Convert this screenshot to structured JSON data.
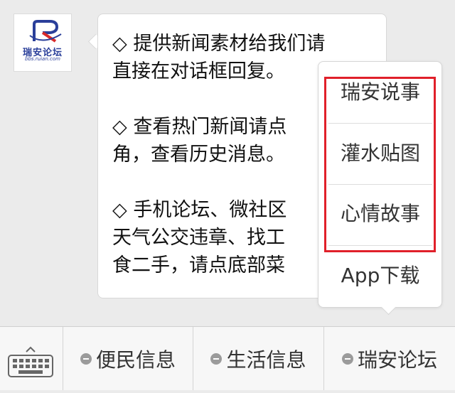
{
  "avatar": {
    "logo_text": "瑞安论坛",
    "logo_url": "bbs.ruian.com"
  },
  "message": {
    "paragraphs": [
      [
        "◇  提供新闻素材给我们请",
        "直接在对话框回复。"
      ],
      [
        "◇  查看热门新闻请点",
        "角，查看历史消息。"
      ],
      [
        "◇  手机论坛、微社区",
        "天气公交违章、找工",
        "食二手，请点底部菜"
      ]
    ]
  },
  "popup_menu": {
    "items": [
      "瑞安说事",
      "灌水贴图",
      "心情故事",
      "App下载"
    ]
  },
  "bottom_menu": {
    "items": [
      "便民信息",
      "生活信息",
      "瑞安论坛"
    ]
  },
  "colors": {
    "highlight": "#e0202a",
    "background": "#ebebeb"
  }
}
